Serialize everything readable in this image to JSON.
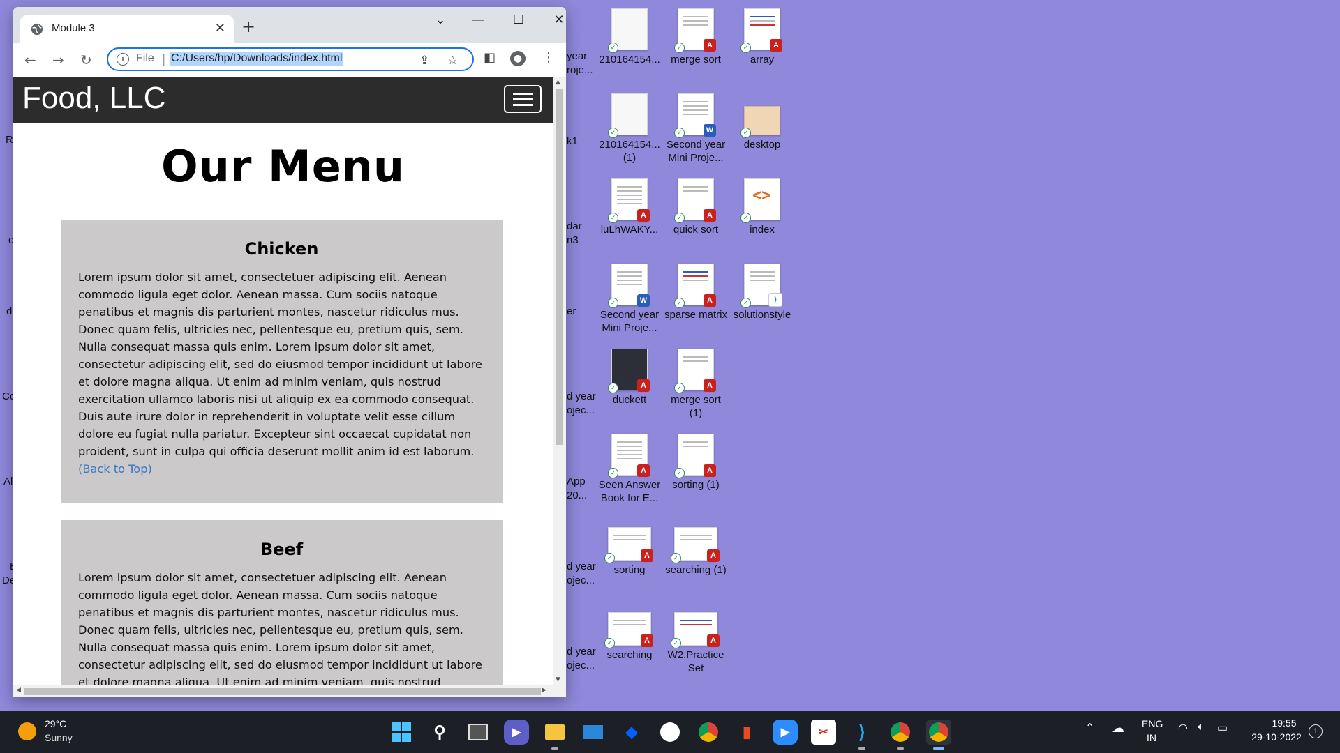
{
  "browser": {
    "tab_title": "Module 3",
    "new_tab_symbol": "+",
    "url_scheme": "File",
    "url": "C:/Users/hp/Downloads/index.html"
  },
  "page": {
    "brand": "Food, LLC",
    "title": "Our Menu",
    "sections": [
      {
        "heading": "Chicken",
        "body": "Lorem ipsum dolor sit amet, consectetuer adipiscing elit. Aenean commodo ligula eget dolor. Aenean massa. Cum sociis natoque penatibus et magnis dis parturient montes, nascetur ridiculus mus. Donec quam felis, ultricies nec, pellentesque eu, pretium quis, sem. Nulla consequat massa quis enim. Lorem ipsum dolor sit amet, consectetur adipiscing elit, sed do eiusmod tempor incididunt ut labore et dolore magna aliqua. Ut enim ad minim veniam, quis nostrud exercitation ullamco laboris nisi ut aliquip ex ea commodo consequat. Duis aute irure dolor in reprehenderit in voluptate velit esse cillum dolore eu fugiat nulla pariatur. Excepteur sint occaecat cupidatat non proident, sunt in culpa qui officia deserunt mollit anim id est laborum.",
        "link": "(Back to Top)"
      },
      {
        "heading": "Beef",
        "body": "Lorem ipsum dolor sit amet, consectetuer adipiscing elit. Aenean commodo ligula eget dolor. Aenean massa. Cum sociis natoque penatibus et magnis dis parturient montes, nascetur ridiculus mus. Donec quam felis, ultricies nec, pellentesque eu, pretium quis, sem. Nulla consequat massa quis enim. Lorem ipsum dolor sit amet, consectetur adipiscing elit, sed do eiusmod tempor incididunt ut labore et dolore magna aliqua. Ut enim ad minim veniam, quis nostrud exercitation ullamco laboris nisi"
      }
    ]
  },
  "desktop": {
    "partial_labels": [
      "year",
      "roje...",
      "k1",
      "dar",
      "n3",
      "er",
      "d year",
      "ojec...",
      "App",
      "20...",
      "d year",
      "ojec...",
      "d year",
      "ojec..."
    ],
    "left_edge": [
      "R",
      "c",
      "d",
      "Co",
      "Al",
      "E",
      "De"
    ],
    "icons": [
      {
        "label": "210164154...",
        "type": "blank"
      },
      {
        "label": "merge sort",
        "type": "pdf"
      },
      {
        "label": "array",
        "type": "pdf"
      },
      {
        "label": "210164154...\n(1)",
        "type": "blank"
      },
      {
        "label": "Second year\nMini Proje...",
        "type": "word"
      },
      {
        "label": "desktop",
        "type": "monitor"
      },
      {
        "label": "luLhWAKY...",
        "type": "pdf"
      },
      {
        "label": "quick sort",
        "type": "pdf"
      },
      {
        "label": "index",
        "type": "code"
      },
      {
        "label": "Second year\nMini Proje...",
        "type": "word"
      },
      {
        "label": "sparse matrix",
        "type": "pdf"
      },
      {
        "label": "solutionstyle",
        "type": "vscode"
      },
      {
        "label": "duckett",
        "type": "dark"
      },
      {
        "label": "merge sort\n(1)",
        "type": "pdf"
      },
      {
        "label": "Seen Answer\nBook for E...",
        "type": "pdf"
      },
      {
        "label": "sorting (1)",
        "type": "pdf"
      },
      {
        "label": "sorting",
        "type": "pdf"
      },
      {
        "label": "searching (1)",
        "type": "pdf"
      },
      {
        "label": "searching",
        "type": "pdf"
      },
      {
        "label": "W2.Practice\nSet",
        "type": "pdf"
      }
    ]
  },
  "taskbar": {
    "temperature": "29°C",
    "condition": "Sunny",
    "language": "ENG",
    "region": "IN",
    "time": "19:55",
    "date": "29-10-2022",
    "notification_count": "1"
  },
  "colors": {
    "desktop_bg": "#8f88db",
    "site_header": "#2d2c2c",
    "section_bg": "#cbc9c9",
    "link": "#3a79c4",
    "taskbar": "#1c1f26"
  }
}
